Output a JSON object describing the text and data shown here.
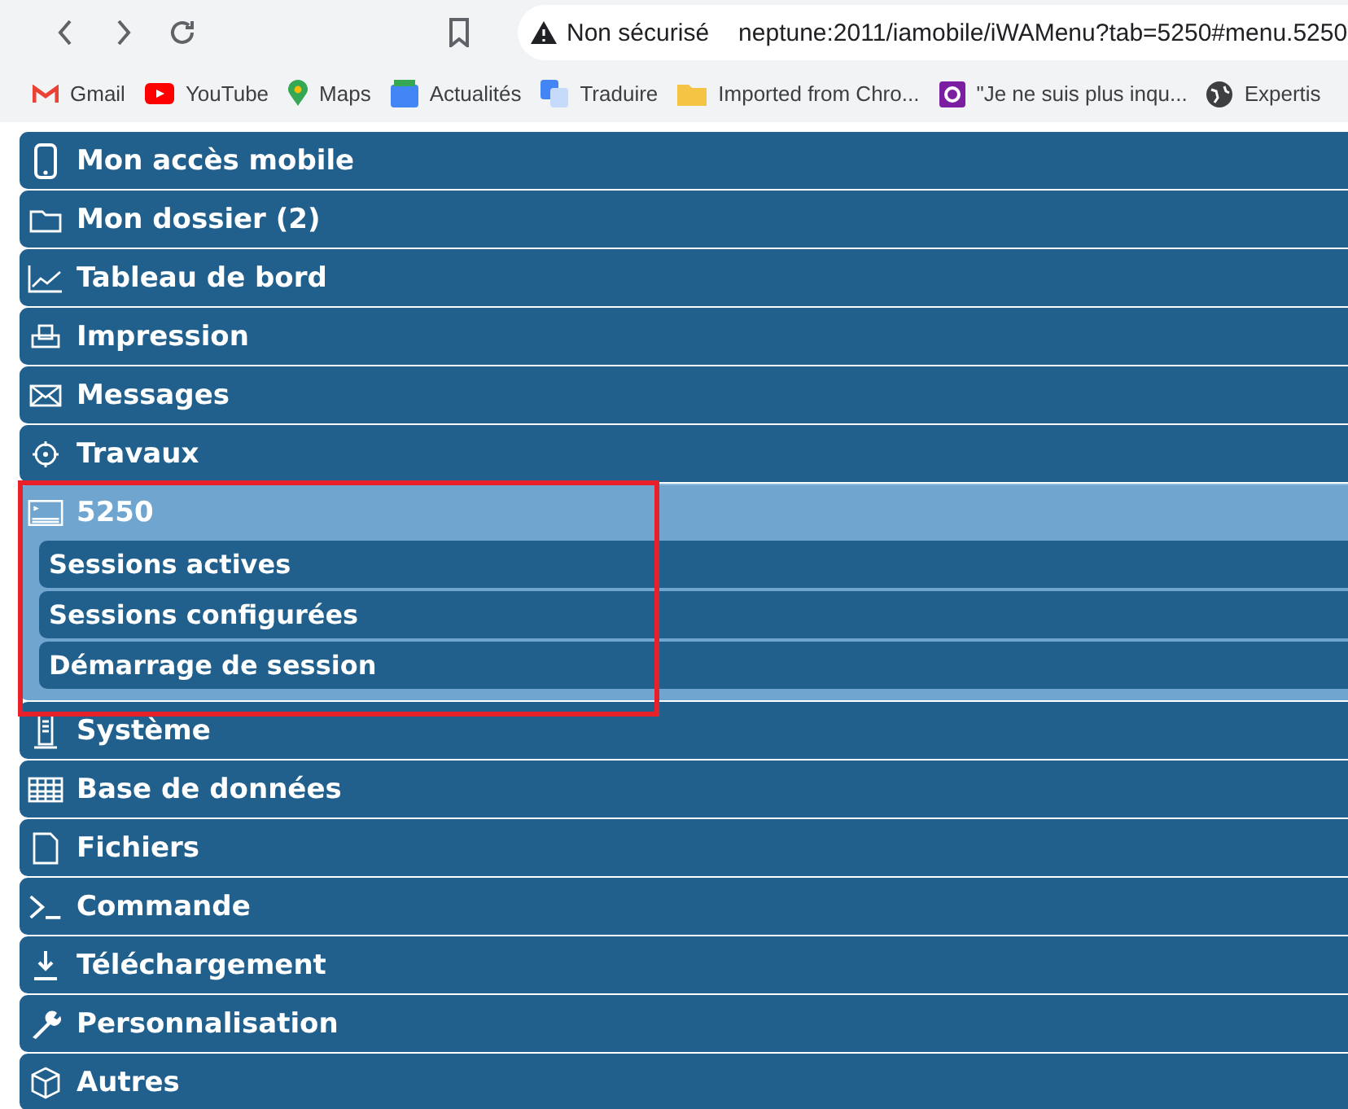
{
  "browser": {
    "security": "Non sécurisé",
    "url": "neptune:2011/iamobile/iWAMenu?tab=5250#menu.5250",
    "bookmarks": [
      "Gmail",
      "YouTube",
      "Maps",
      "Actualités",
      "Traduire",
      "Imported from Chro...",
      "\"Je ne suis plus inqu...",
      "Expertis"
    ]
  },
  "menu": [
    {
      "label": "Mon accès mobile",
      "expanded": false
    },
    {
      "label": "Mon dossier (2)",
      "expanded": false
    },
    {
      "label": "Tableau de bord",
      "expanded": false
    },
    {
      "label": "Impression",
      "expanded": false
    },
    {
      "label": "Messages",
      "expanded": false
    },
    {
      "label": "Travaux",
      "expanded": false
    },
    {
      "label": "5250",
      "expanded": true,
      "children": [
        {
          "label": "Sessions actives"
        },
        {
          "label": "Sessions configurées"
        },
        {
          "label": "Démarrage de session"
        }
      ]
    },
    {
      "label": "Système",
      "expanded": false
    },
    {
      "label": "Base de données",
      "expanded": false
    },
    {
      "label": "Fichiers",
      "expanded": false
    },
    {
      "label": "Commande",
      "expanded": false
    },
    {
      "label": "Téléchargement",
      "expanded": false
    },
    {
      "label": "Personnalisation",
      "expanded": false
    },
    {
      "label": "Autres",
      "expanded": false
    }
  ]
}
